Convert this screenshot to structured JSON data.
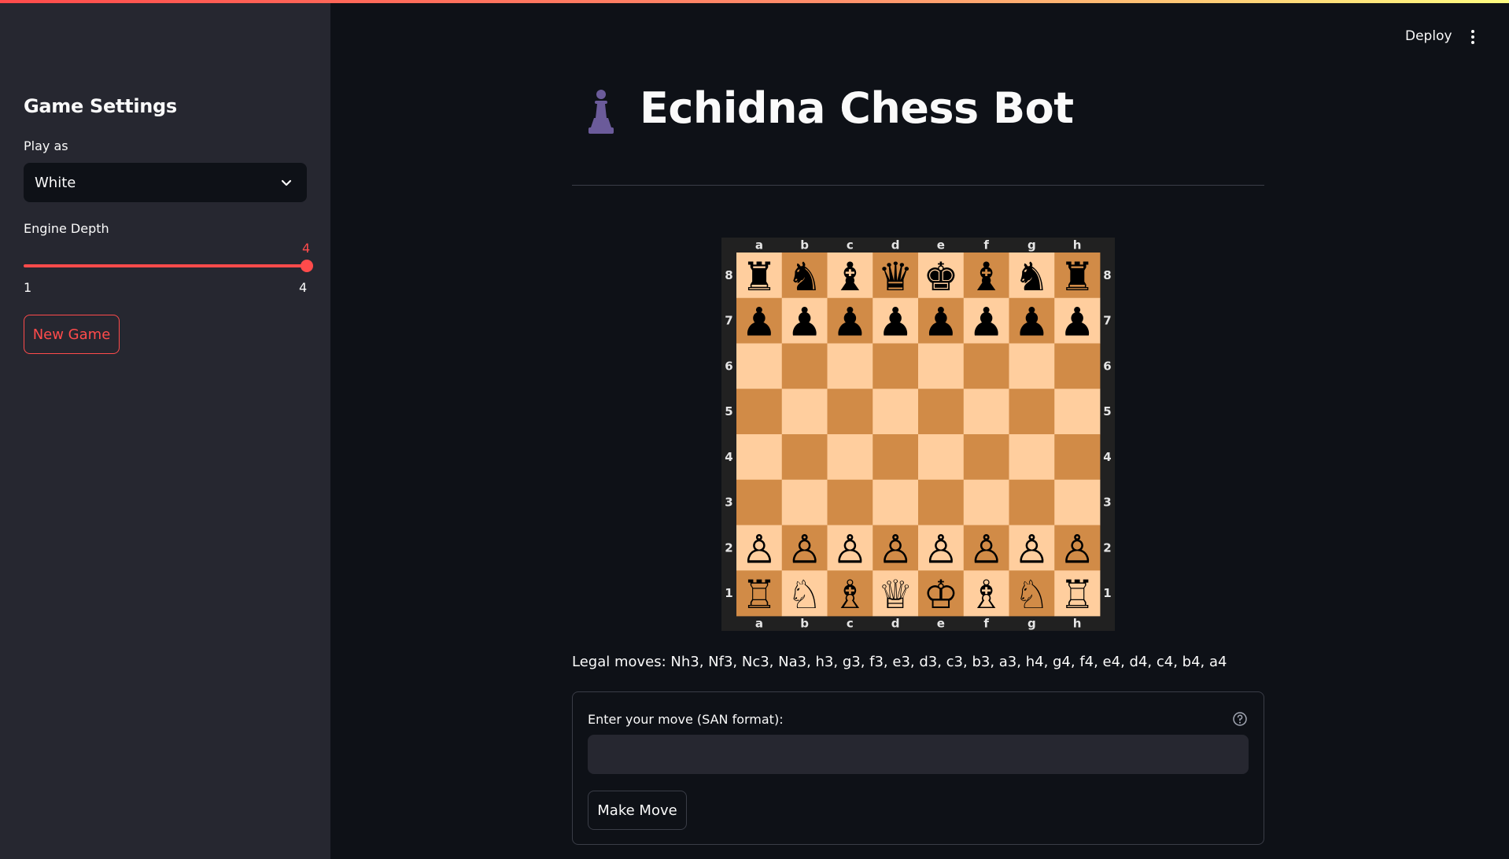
{
  "header": {
    "deploy_label": "Deploy",
    "menu_icon": "vertical-dots-icon"
  },
  "sidebar": {
    "title": "Game Settings",
    "play_as": {
      "label": "Play as",
      "value": "White"
    },
    "engine_depth": {
      "label": "Engine Depth",
      "value": "4",
      "min": "1",
      "max": "4"
    },
    "new_game_label": "New Game"
  },
  "main": {
    "icon": "pawn-icon",
    "title": "Echidna Chess Bot",
    "legal_moves": "Legal moves: Nh3, Nf3, Nc3, Na3, h3, g3, f3, e3, d3, c3, b3, a3, h4, g4, f4, e4, d4, c4, b4, a4",
    "move_form": {
      "label": "Enter your move (SAN format):",
      "input_value": "",
      "help_icon": "help-circle-icon",
      "button_label": "Make Move"
    }
  },
  "board": {
    "files": [
      "a",
      "b",
      "c",
      "d",
      "e",
      "f",
      "g",
      "h"
    ],
    "ranks": [
      "8",
      "7",
      "6",
      "5",
      "4",
      "3",
      "2",
      "1"
    ],
    "position": [
      [
        "♜",
        "♞",
        "♝",
        "♛",
        "♚",
        "♝",
        "♞",
        "♜"
      ],
      [
        "♟",
        "♟",
        "♟",
        "♟",
        "♟",
        "♟",
        "♟",
        "♟"
      ],
      [
        "",
        "",
        "",
        "",
        "",
        "",
        "",
        ""
      ],
      [
        "",
        "",
        "",
        "",
        "",
        "",
        "",
        ""
      ],
      [
        "",
        "",
        "",
        "",
        "",
        "",
        "",
        ""
      ],
      [
        "",
        "",
        "",
        "",
        "",
        "",
        "",
        ""
      ],
      [
        "♙",
        "♙",
        "♙",
        "♙",
        "♙",
        "♙",
        "♙",
        "♙"
      ],
      [
        "♖",
        "♘",
        "♗",
        "♕",
        "♔",
        "♗",
        "♘",
        "♖"
      ]
    ],
    "colors": {
      "light": "#ffce9e",
      "dark": "#d18b47",
      "frame": "#212121",
      "label": "#e5e5e5"
    }
  },
  "colors": {
    "accent": "#ff4b4b",
    "background": "#0e1117",
    "sidebar": "#262730",
    "pawn_icon": "#6b5b9a"
  }
}
